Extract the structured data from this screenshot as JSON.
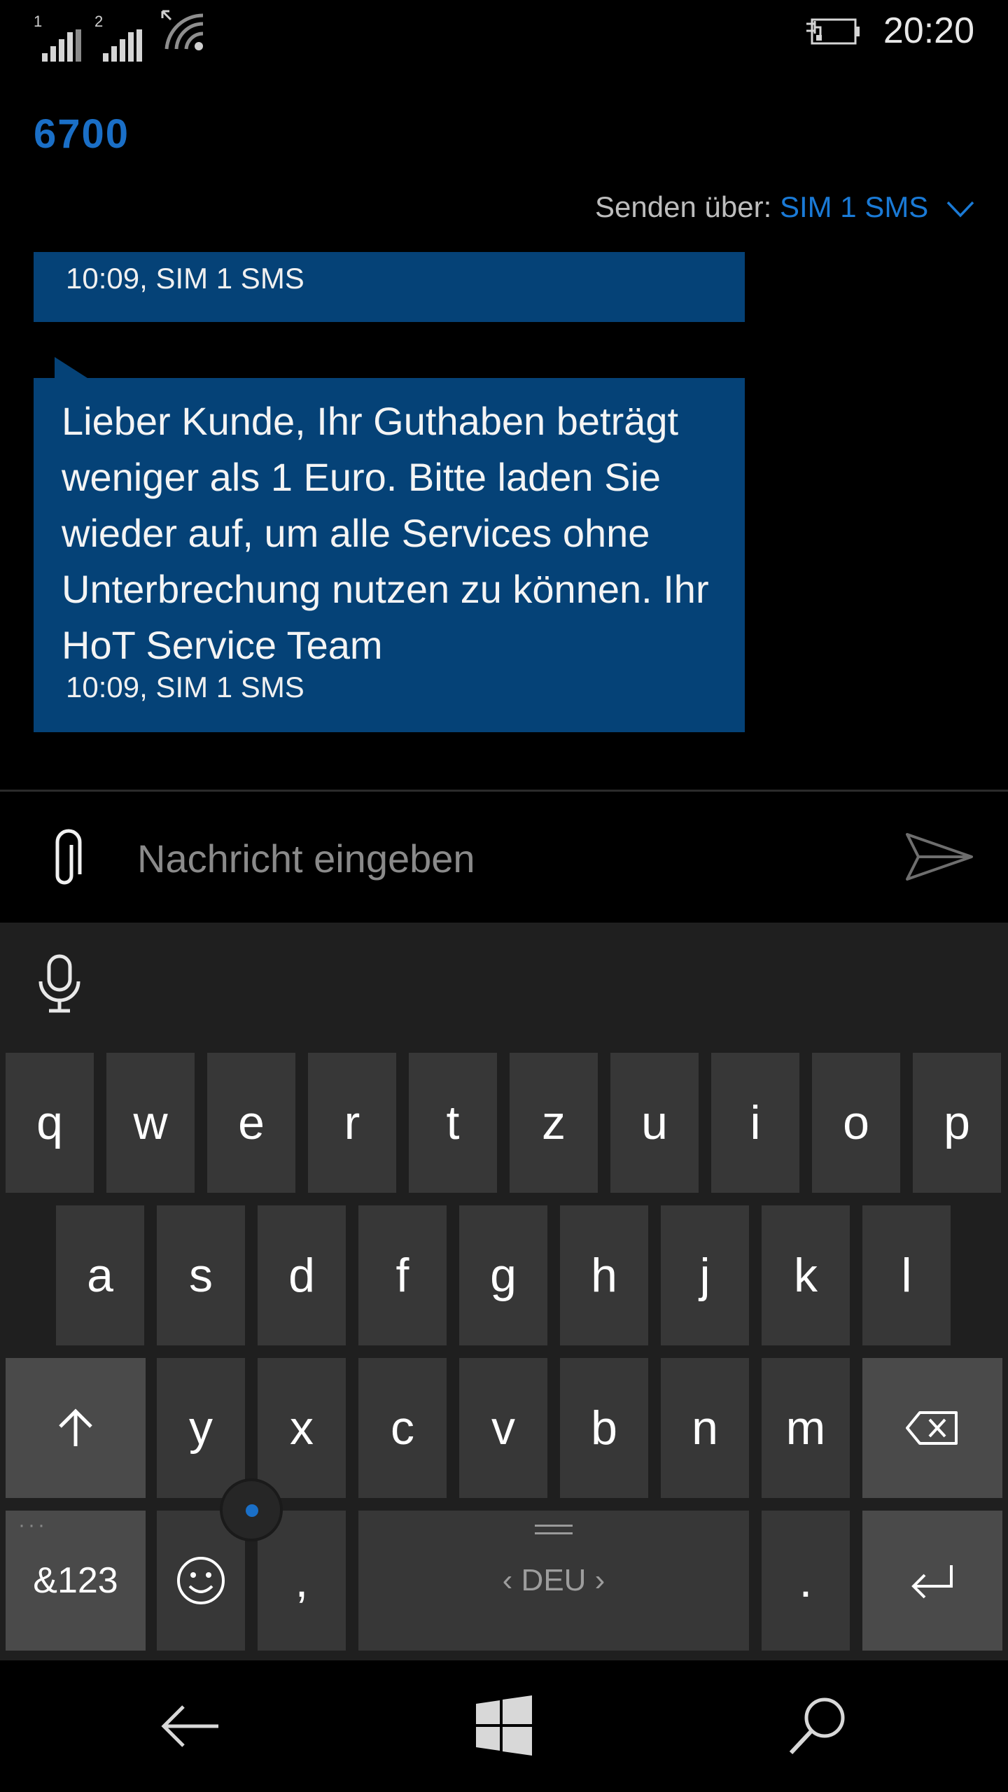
{
  "status": {
    "sim1_label": "1",
    "sim2_label": "2",
    "time": "20:20"
  },
  "header": {
    "title": "6700",
    "send_via_label": "Senden über:",
    "send_via_value": "SIM 1 SMS"
  },
  "messages": [
    {
      "meta": "10:09, SIM 1 SMS"
    },
    {
      "text": "Lieber Kunde, Ihr Guthaben beträgt weniger als 1 Euro. Bitte laden Sie wieder auf, um alle Services ohne Unterbrechung nutzen zu können. Ihr HoT Service Team",
      "meta": "10:09, SIM 1 SMS"
    }
  ],
  "compose": {
    "placeholder": "Nachricht eingeben"
  },
  "keyboard": {
    "row1": [
      "q",
      "w",
      "e",
      "r",
      "t",
      "z",
      "u",
      "i",
      "o",
      "p"
    ],
    "row2": [
      "a",
      "s",
      "d",
      "f",
      "g",
      "h",
      "j",
      "k",
      "l"
    ],
    "row3": [
      "y",
      "x",
      "c",
      "v",
      "b",
      "n",
      "m"
    ],
    "symbols_label": "&123",
    "comma": ",",
    "period": ".",
    "language": "‹ DEU ›"
  },
  "colors": {
    "accent": "#1a6fc7",
    "bubble": "#054277",
    "background": "#000000",
    "key": "#373737"
  },
  "icons": [
    "signal-icon",
    "wifi-icon",
    "battery-charging-icon",
    "chevron-down-icon",
    "paperclip-icon",
    "send-icon",
    "microphone-icon",
    "shift-icon",
    "backspace-icon",
    "emoji-icon",
    "enter-icon",
    "back-arrow-icon",
    "windows-icon",
    "search-icon"
  ]
}
